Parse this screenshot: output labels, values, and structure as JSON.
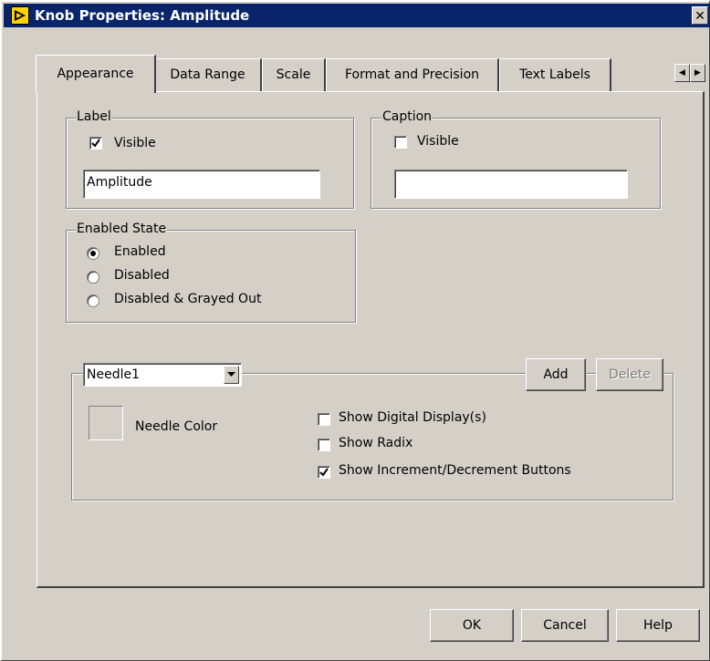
{
  "window": {
    "title": "Knob Properties: Amplitude",
    "close_glyph": "✕"
  },
  "tabs": [
    {
      "label": "Appearance",
      "active": true
    },
    {
      "label": "Data Range"
    },
    {
      "label": "Scale"
    },
    {
      "label": "Format and Precision"
    },
    {
      "label": "Text Labels"
    }
  ],
  "label_group": {
    "title": "Label",
    "visible_label": "Visible",
    "visible_checked": true,
    "value": "Amplitude"
  },
  "caption_group": {
    "title": "Caption",
    "visible_label": "Visible",
    "visible_checked": false,
    "value": ""
  },
  "enabled_state": {
    "title": "Enabled State",
    "options": [
      "Enabled",
      "Disabled",
      "Disabled & Grayed Out"
    ],
    "selected": "Enabled"
  },
  "needle": {
    "selected": "Needle1",
    "add_label": "Add",
    "delete_label": "Delete",
    "color_label": "Needle Color",
    "options": [
      {
        "label": "Show Digital Display(s)",
        "checked": false
      },
      {
        "label": "Show Radix",
        "checked": false
      },
      {
        "label": "Show Increment/Decrement Buttons",
        "checked": true
      }
    ]
  },
  "footer": {
    "ok_label": "OK",
    "cancel_label": "Cancel",
    "help_label": "Help"
  },
  "icons": {
    "app": "labview-arrow-icon",
    "close": "close-icon",
    "tab_left": "scroll-left-icon",
    "tab_right": "scroll-right-icon",
    "dropdown": "chevron-down-icon"
  },
  "colors": {
    "titlebar": "#0a246a",
    "face": "#d4d0c8",
    "app_icon": "#ffd200"
  }
}
